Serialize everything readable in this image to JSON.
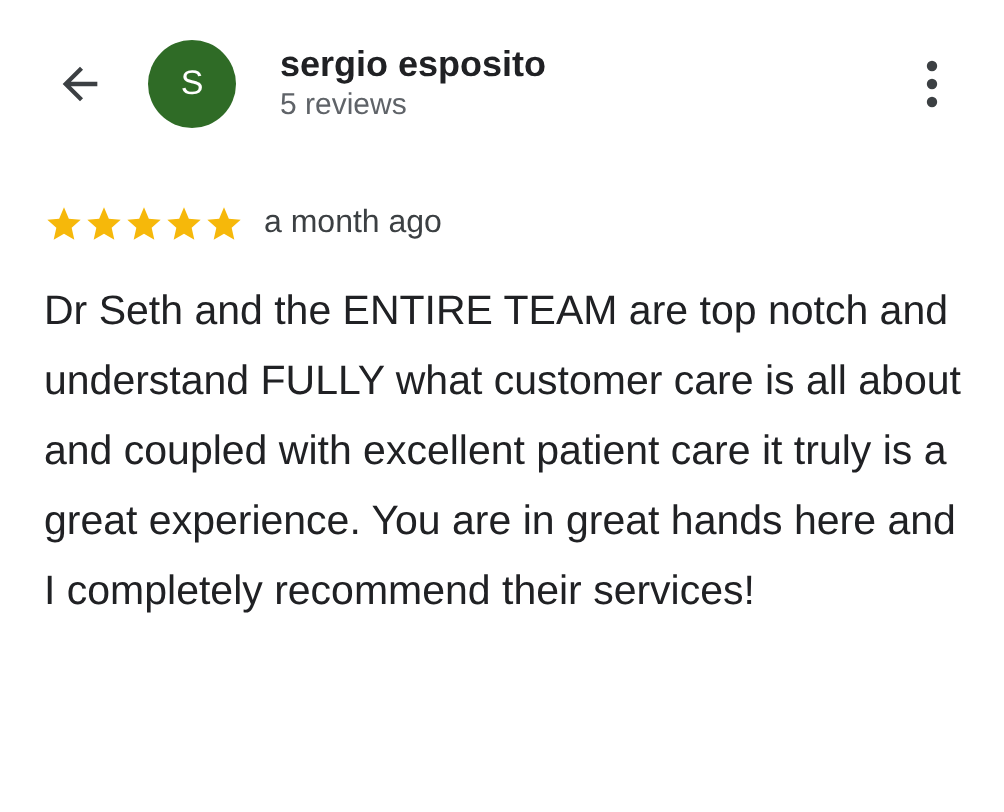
{
  "reviewer": {
    "initial": "S",
    "name": "sergio esposito",
    "reviews": "5 reviews"
  },
  "review": {
    "stars": 5,
    "time": "a month ago",
    "text": "Dr Seth and the ENTIRE TEAM are top notch and understand FULLY what customer care is all about and coupled with excellent patient care it truly is a great experience. You are in great hands here and I completely recommend their services!"
  }
}
